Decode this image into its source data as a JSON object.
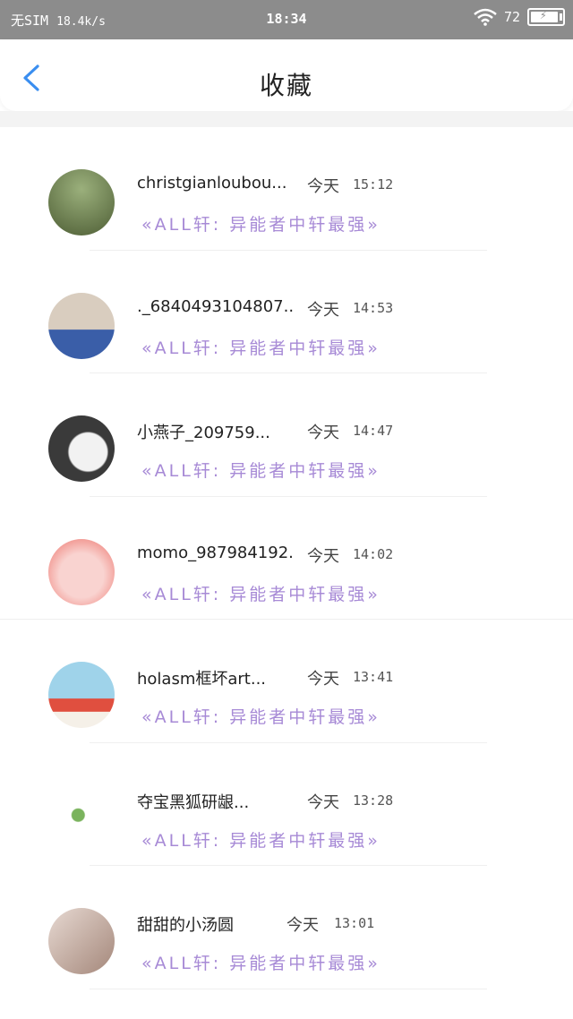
{
  "status_bar": {
    "carrier": "无SIM",
    "speed": "18.4k/s",
    "time": "18:34",
    "battery": "72"
  },
  "header": {
    "title": "收藏"
  },
  "items": [
    {
      "name": "christgianloubou...",
      "date": "今天",
      "time": "15:12",
      "text": "«ALL轩: 异能者中轩最强»",
      "avatar_colors": [
        "#9bb07c",
        "#5d6e43"
      ]
    },
    {
      "name": "._6840493104807...",
      "date": "今天",
      "time": "14:53",
      "text": "«ALL轩: 异能者中轩最强»",
      "avatar_colors": [
        "#d9cdbf",
        "#3a5ea8"
      ]
    },
    {
      "name": "小燕子_209759...",
      "date": "今天",
      "time": "14:47",
      "text": "«ALL轩: 异能者中轩最强»",
      "avatar_colors": [
        "#f2f2f2",
        "#3a3a3a"
      ]
    },
    {
      "name": "momo_987984192...",
      "date": "今天",
      "time": "14:02",
      "text": "«ALL轩: 异能者中轩最强»",
      "avatar_colors": [
        "#f9d3d0",
        "#f29b95"
      ]
    },
    {
      "name": "holasm框坏art...",
      "date": "今天",
      "time": "13:41",
      "text": "«ALL轩: 异能者中轩最强»",
      "avatar_colors": [
        "#9fd3ea",
        "#e04f3f"
      ]
    },
    {
      "name": "夺宝黑狐研龈...",
      "date": "今天",
      "time": "13:28",
      "text": "«ALL轩: 异能者中轩最强»",
      "avatar_colors": [
        "#ffffff",
        "#7ab35d"
      ]
    },
    {
      "name": "甜甜的小汤圆",
      "date": "今天",
      "time": "13:01",
      "text": "«ALL轩: 异能者中轩最强»",
      "avatar_colors": [
        "#e7d9d2",
        "#a4877a"
      ]
    }
  ]
}
